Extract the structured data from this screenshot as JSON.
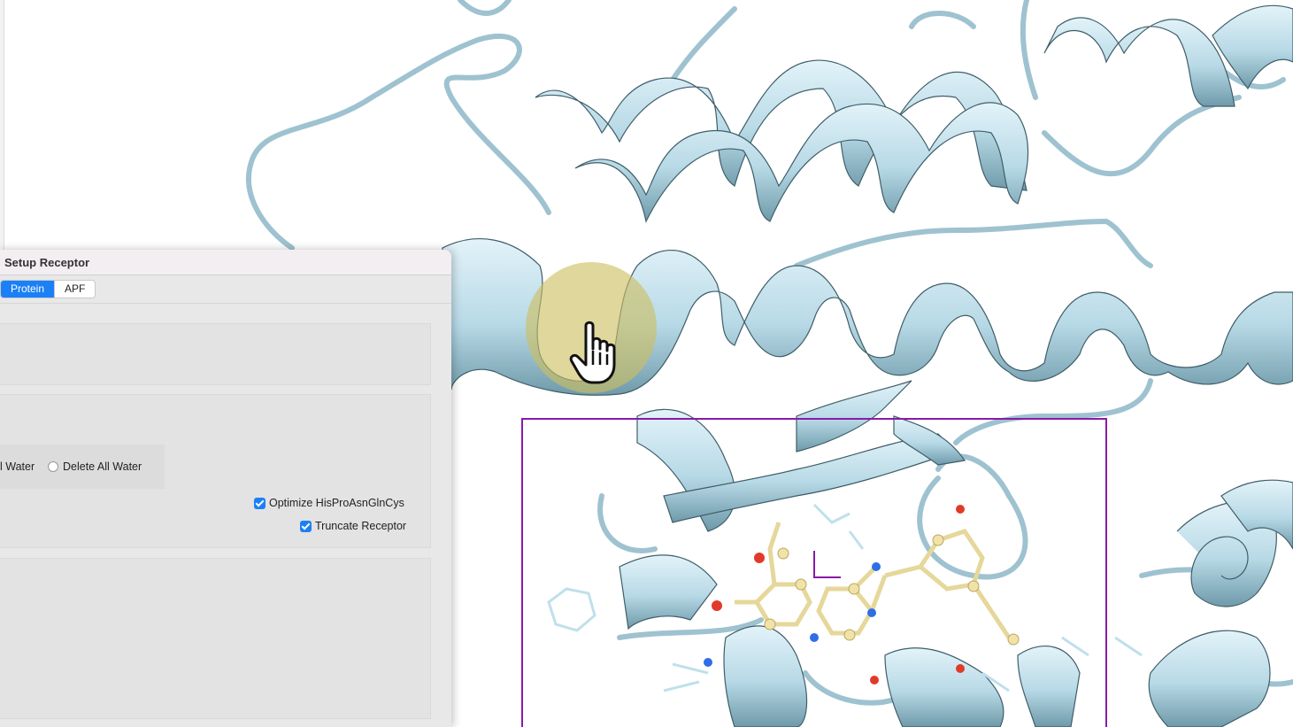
{
  "viewer": {
    "name": "protein-structure-viewer",
    "colors": {
      "ribbon": "#bfe0ec",
      "ribbon_dark": "#6f9aaa",
      "box": "#8a1aa8",
      "ligand": "#f2e2a8",
      "oxygen": "#e23a2a",
      "nitrogen": "#2f6ee6"
    }
  },
  "panel": {
    "title": "Setup Receptor",
    "tabs": [
      {
        "label": "Protein",
        "active": true
      },
      {
        "label": "APF",
        "active": false
      }
    ],
    "water": {
      "option_partial": "l Water",
      "option_delete_all": "Delete All Water"
    },
    "checkboxes": {
      "optimize": {
        "label": "Optimize HisProAsnGlnCys",
        "checked": true
      },
      "truncate": {
        "label": "Truncate Receptor",
        "checked": true
      }
    }
  }
}
